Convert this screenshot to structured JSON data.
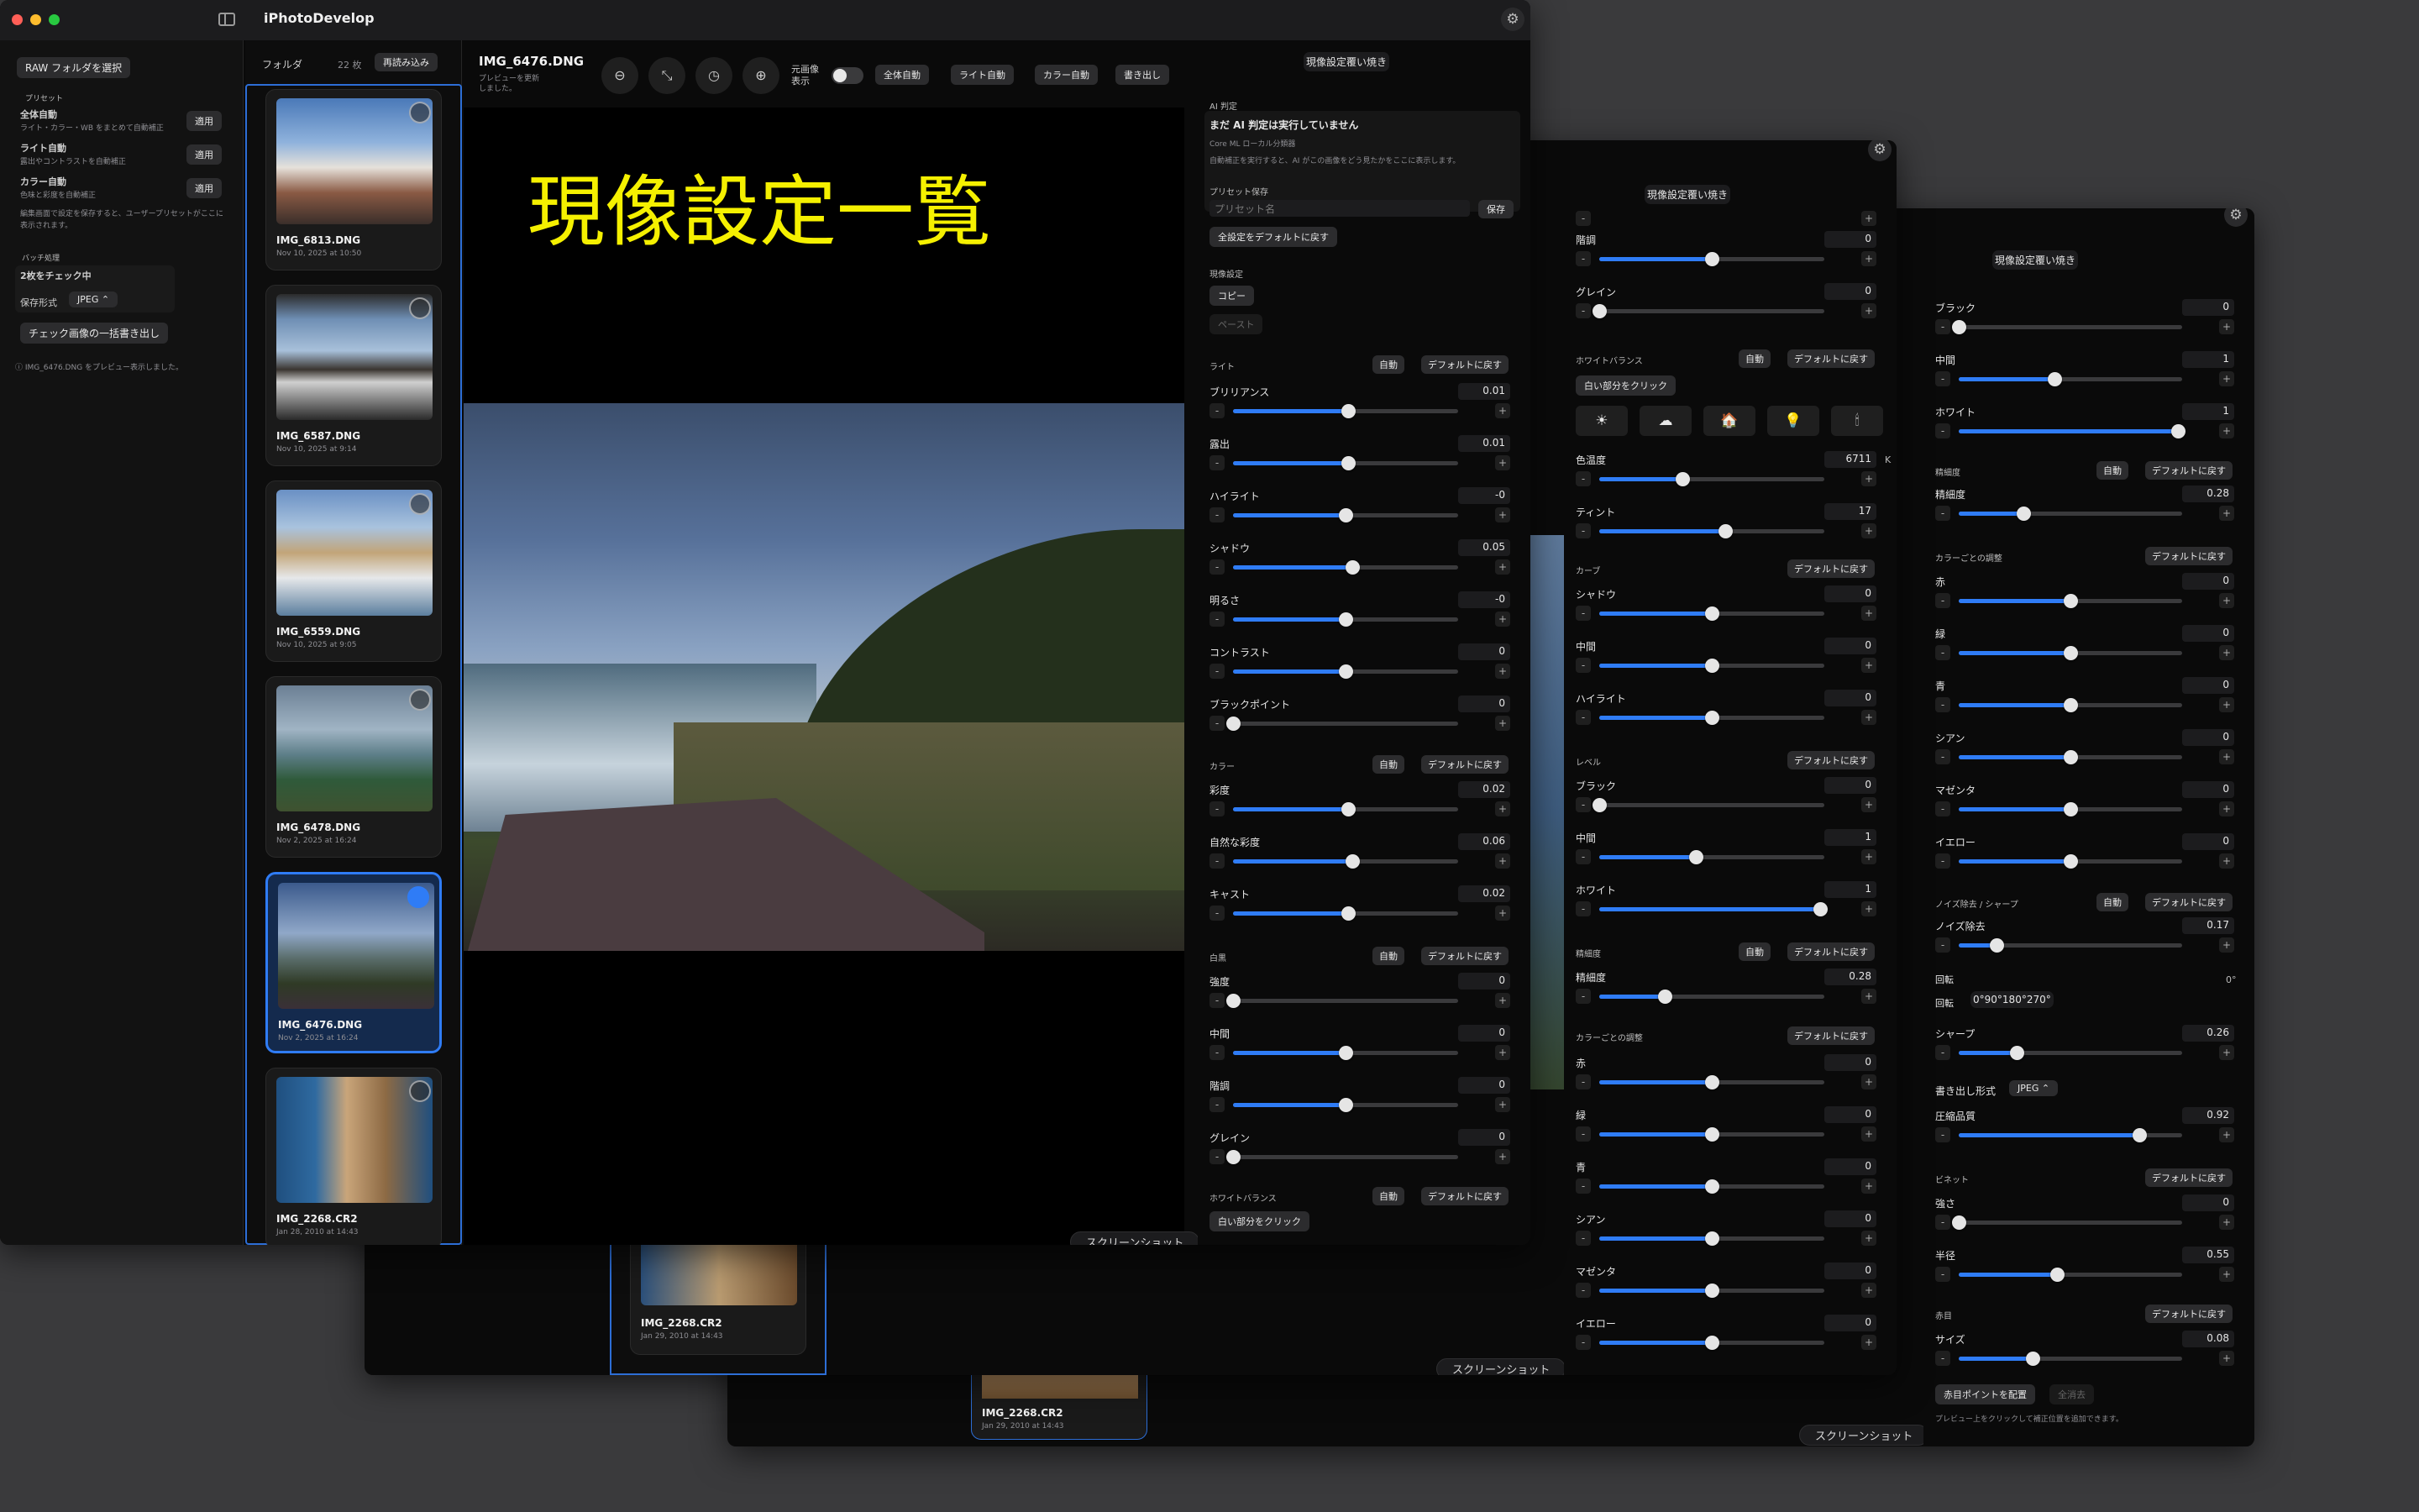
{
  "app": {
    "title": "iPhotoDevelop",
    "screenshot_label": "スクリーンショット"
  },
  "left": {
    "select_folder": "RAW フォルダを選択",
    "preset_heading": "プリセット",
    "presets": [
      {
        "name": "全体自動",
        "desc": "ライト・カラー・WB をまとめて自動補正",
        "apply": "適用"
      },
      {
        "name": "ライト自動",
        "desc": "露出やコントラストを自動補正",
        "apply": "適用"
      },
      {
        "name": "カラー自動",
        "desc": "色味と彩度を自動補正",
        "apply": "適用"
      }
    ],
    "preset_note": "編集画面で設定を保存すると、ユーザープリセットがここに表示されます。",
    "batch_heading": "バッチ処理",
    "checked_count": "2枚をチェック中",
    "format_label": "保存形式",
    "format_value": "JPEG",
    "batch_export": "チェック画像の一括書き出し",
    "status": "IMG_6476.DNG をプレビュー表示しました。"
  },
  "thumbs": {
    "folder_label": "フォルダ",
    "count": "22 枚",
    "reload": "再読み込み",
    "items": [
      {
        "name": "IMG_6813.DNG",
        "date": "Nov 10, 2025 at 10:50",
        "selected": false,
        "checked": false
      },
      {
        "name": "IMG_6587.DNG",
        "date": "Nov 10, 2025 at 9:14",
        "selected": false,
        "checked": false
      },
      {
        "name": "IMG_6559.DNG",
        "date": "Nov 10, 2025 at 9:05",
        "selected": false,
        "checked": false
      },
      {
        "name": "IMG_6478.DNG",
        "date": "Nov 2, 2025 at 16:24",
        "selected": false,
        "checked": false
      },
      {
        "name": "IMG_6476.DNG",
        "date": "Nov 2, 2025 at 16:24",
        "selected": true,
        "checked": true
      },
      {
        "name": "IMG_2268.CR2",
        "date": "Jan 28, 2010 at 14:43",
        "selected": false,
        "checked": false
      }
    ]
  },
  "back_thumbs": {
    "mid": {
      "name": "IMG_2268.CR2",
      "date": "Jan 29, 2010 at 14:43"
    },
    "back": {
      "name": "IMG_2268.CR2",
      "date": "Jan 29, 2010 at 14:43"
    }
  },
  "toolbar": {
    "filename": "IMG_6476.DNG",
    "status1": "プレビューを更新",
    "status2": "しました。",
    "original_toggle_label1": "元画像",
    "original_toggle_label2": "表示",
    "auto_all": "全体自動",
    "auto_light": "ライト自動",
    "auto_color": "カラー自動",
    "export": "書き出し"
  },
  "overlay_title": "現像設定一覧",
  "panel": {
    "tab_develop": "現像設定",
    "tab_overwrite": "覆い焼き",
    "ai_heading": "AI 判定",
    "ai_status": "まだ AI 判定は実行していません",
    "ai_model": "Core ML ローカル分類器",
    "ai_desc": "自動補正を実行すると、AI がこの画像をどう見たかをここに表示します。",
    "preset_save_heading": "プリセット保存",
    "preset_name_placeholder": "プリセット名",
    "save": "保存",
    "reset_all": "全設定をデフォルトに戻す",
    "develop_heading": "現像設定",
    "copy": "コピー",
    "paste": "ペースト",
    "auto": "自動",
    "reset": "デフォルトに戻す",
    "white_click": "白い部分をクリック",
    "kelvin": "K",
    "rotation_label": "回転",
    "rotation_value": "0°",
    "rotations": [
      "0°",
      "90°",
      "180°",
      "270°"
    ],
    "export_format_label": "書き出し形式",
    "export_format_value": "JPEG",
    "redeye_place": "赤目ポイントを配置",
    "redeye_clear": "全消去",
    "redeye_note": "プレビュー上をクリックして補正位置を追加できます。",
    "sections": {
      "light": "ライト",
      "color": "カラー",
      "bw": "白黒",
      "wb": "ホワイトバランス",
      "curve": "カーブ",
      "level": "レベル",
      "detail": "精細度",
      "hsl": "カラーごとの調整",
      "nr": "ノイズ除去 / シャープ",
      "vignette": "ビネット",
      "redeye": "赤目"
    }
  },
  "sliders": {
    "brilliance": {
      "label": "ブリリアンス",
      "value": "0.01",
      "pos": 0.51
    },
    "exposure": {
      "label": "露出",
      "value": "0.01",
      "pos": 0.51
    },
    "highlights": {
      "label": "ハイライト",
      "value": "-0",
      "pos": 0.5
    },
    "shadows": {
      "label": "シャドウ",
      "value": "0.05",
      "pos": 0.53
    },
    "brightness": {
      "label": "明るさ",
      "value": "-0",
      "pos": 0.5
    },
    "contrast": {
      "label": "コントラスト",
      "value": "0",
      "pos": 0.5
    },
    "blackpoint": {
      "label": "ブラックポイント",
      "value": "0",
      "pos": 0.0
    },
    "saturation": {
      "label": "彩度",
      "value": "0.02",
      "pos": 0.51
    },
    "vibrance": {
      "label": "自然な彩度",
      "value": "0.06",
      "pos": 0.53
    },
    "cast": {
      "label": "キャスト",
      "value": "0.02",
      "pos": 0.51
    },
    "bw_strength": {
      "label": "強度",
      "value": "0",
      "pos": 0.0
    },
    "bw_mid": {
      "label": "中間",
      "value": "0",
      "pos": 0.5
    },
    "bw_tone": {
      "label": "階調",
      "value": "0",
      "pos": 0.5
    },
    "bw_grain": {
      "label": "グレイン",
      "value": "0",
      "pos": 0.0
    },
    "temp": {
      "label": "色温度",
      "value": "6711",
      "pos": 0.37
    },
    "tint": {
      "label": "ティント",
      "value": "17",
      "pos": 0.56
    },
    "curve_shadow": {
      "label": "シャドウ",
      "value": "0",
      "pos": 0.5
    },
    "curve_mid": {
      "label": "中間",
      "value": "0",
      "pos": 0.5
    },
    "curve_high": {
      "label": "ハイライト",
      "value": "0",
      "pos": 0.5
    },
    "level_black": {
      "label": "ブラック",
      "value": "0",
      "pos": 0.0
    },
    "level_mid": {
      "label": "中間",
      "value": "1",
      "pos": 0.43
    },
    "level_white": {
      "label": "ホワイト",
      "value": "1",
      "pos": 0.98
    },
    "detail": {
      "label": "精細度",
      "value": "0.28",
      "pos": 0.29
    },
    "hsl_red": {
      "label": "赤",
      "value": "0",
      "pos": 0.5
    },
    "hsl_green": {
      "label": "緑",
      "value": "0",
      "pos": 0.5
    },
    "hsl_blue": {
      "label": "青",
      "value": "0",
      "pos": 0.5
    },
    "hsl_cyan": {
      "label": "シアン",
      "value": "0",
      "pos": 0.5
    },
    "hsl_magenta": {
      "label": "マゼンタ",
      "value": "0",
      "pos": 0.5
    },
    "hsl_yellow": {
      "label": "イエロー",
      "value": "0",
      "pos": 0.5
    },
    "noise": {
      "label": "ノイズ除去",
      "value": "0.17",
      "pos": 0.17
    },
    "sharp": {
      "label": "シャープ",
      "value": "0.26",
      "pos": 0.26
    },
    "quality": {
      "label": "圧縮品質",
      "value": "0.92",
      "pos": 0.81
    },
    "vig_strength": {
      "label": "強さ",
      "value": "0",
      "pos": 0.0
    },
    "vig_radius": {
      "label": "半径",
      "value": "0.55",
      "pos": 0.44
    },
    "redeye_size": {
      "label": "サイズ",
      "value": "0.08",
      "pos": 0.33
    }
  },
  "colors": {
    "accent": "#2f7cf6",
    "overlay_text": "#f5f000"
  }
}
